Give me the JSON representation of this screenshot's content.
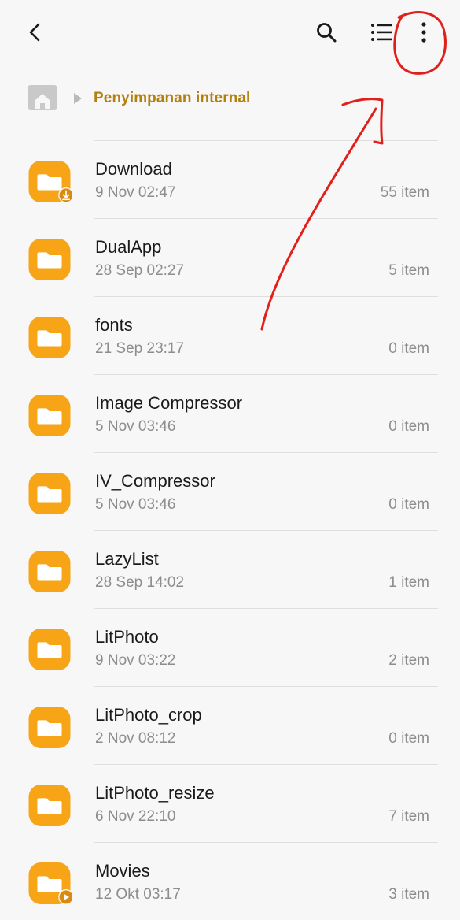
{
  "header": {
    "back_icon": "back-chevron-icon",
    "search_icon": "search-icon",
    "list_view_icon": "list-view-icon",
    "more_icon": "more-vertical-icon"
  },
  "breadcrumb": {
    "home_icon": "home-icon",
    "separator_icon": "triangle-right-icon",
    "current": "Penyimpanan internal"
  },
  "colors": {
    "folder": "#f7a417",
    "breadcrumb_text": "#b3800f",
    "annotation": "#e0201b"
  },
  "folders": [
    {
      "name": "Download",
      "date": "9 Nov 02:47",
      "count": "55 item",
      "badge": "download"
    },
    {
      "name": "DualApp",
      "date": "28 Sep 02:27",
      "count": "5 item",
      "badge": ""
    },
    {
      "name": "fonts",
      "date": "21 Sep 23:17",
      "count": "0 item",
      "badge": ""
    },
    {
      "name": "Image Compressor",
      "date": "5 Nov 03:46",
      "count": "0 item",
      "badge": ""
    },
    {
      "name": "IV_Compressor",
      "date": "5 Nov 03:46",
      "count": "0 item",
      "badge": ""
    },
    {
      "name": "LazyList",
      "date": "28 Sep 14:02",
      "count": "1 item",
      "badge": ""
    },
    {
      "name": "LitPhoto",
      "date": "9 Nov 03:22",
      "count": "2 item",
      "badge": ""
    },
    {
      "name": "LitPhoto_crop",
      "date": "2 Nov 08:12",
      "count": "0 item",
      "badge": ""
    },
    {
      "name": "LitPhoto_resize",
      "date": "6 Nov 22:10",
      "count": "7 item",
      "badge": ""
    },
    {
      "name": "Movies",
      "date": "12 Okt 03:17",
      "count": "3 item",
      "badge": "play"
    }
  ]
}
